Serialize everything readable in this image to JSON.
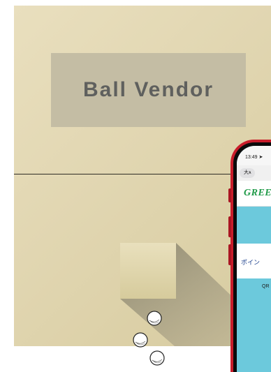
{
  "vendor": {
    "sign_label": "Ball Vendor"
  },
  "phone": {
    "status_time": "13:49",
    "font_size_button": "大ᴀ",
    "logo_text": "GREE",
    "card_title": "ポイン",
    "qr_label": "QR"
  },
  "colors": {
    "machine": "#e1d6b1",
    "sign": "#c4bda4",
    "sign_text": "#5f605e",
    "phone_frame": "#c81d2b",
    "phone_screen": "#6cc9dc",
    "logo": "#1f9a48"
  },
  "icons": {
    "golf_ball": "golf-ball-icon",
    "location_arrow": "location-arrow-icon"
  }
}
